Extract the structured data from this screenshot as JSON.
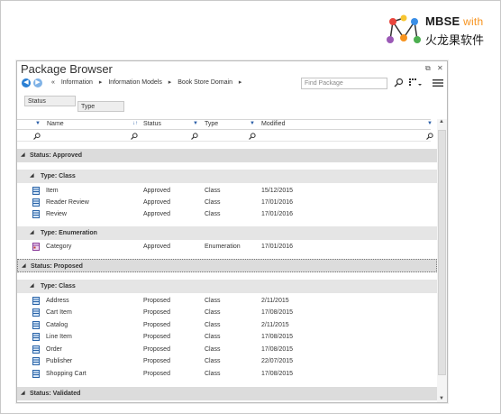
{
  "logo": {
    "brand": "MBSE",
    "with": "with",
    "subtitle": "火龙果软件"
  },
  "window": {
    "title": "Package Browser",
    "pin_glyph": "⧉",
    "close_glyph": "✕"
  },
  "toolbar": {
    "back_glyph": "◀",
    "forward_glyph": "▶",
    "crumbs": [
      "«",
      "Information",
      "Information Models",
      "Book Store Domain"
    ],
    "crumb_sep": "▸",
    "find_placeholder": "Find Package"
  },
  "grouping": {
    "chips": [
      "Status",
      "Type"
    ]
  },
  "columns": {
    "name": "Name",
    "status": "Status",
    "type": "Type",
    "modified": "Modified",
    "sort_glyph": "↓↑"
  },
  "groups": [
    {
      "label": "Status: Approved",
      "subgroups": [
        {
          "label": "Type: Class",
          "rows": [
            {
              "name": "Item",
              "status": "Approved",
              "type": "Class",
              "modified": "15/12/2015",
              "icon": "class-icon"
            },
            {
              "name": "Reader Review",
              "status": "Approved",
              "type": "Class",
              "modified": "17/01/2016",
              "icon": "class-icon"
            },
            {
              "name": "Review",
              "status": "Approved",
              "type": "Class",
              "modified": "17/01/2016",
              "icon": "class-icon"
            }
          ]
        },
        {
          "label": "Type: Enumeration",
          "rows": [
            {
              "name": "Category",
              "status": "Approved",
              "type": "Enumeration",
              "modified": "17/01/2016",
              "icon": "enumeration-icon"
            }
          ]
        }
      ]
    },
    {
      "label": "Status: Proposed",
      "selected": true,
      "subgroups": [
        {
          "label": "Type: Class",
          "rows": [
            {
              "name": "Address",
              "status": "Proposed",
              "type": "Class",
              "modified": "2/11/2015",
              "icon": "class-icon"
            },
            {
              "name": "Cart Item",
              "status": "Proposed",
              "type": "Class",
              "modified": "17/08/2015",
              "icon": "class-icon"
            },
            {
              "name": "Catalog",
              "status": "Proposed",
              "type": "Class",
              "modified": "2/11/2015",
              "icon": "class-icon"
            },
            {
              "name": "Line Item",
              "status": "Proposed",
              "type": "Class",
              "modified": "17/08/2015",
              "icon": "class-icon"
            },
            {
              "name": "Order",
              "status": "Proposed",
              "type": "Class",
              "modified": "17/08/2015",
              "icon": "class-icon"
            },
            {
              "name": "Publisher",
              "status": "Proposed",
              "type": "Class",
              "modified": "22/07/2015",
              "icon": "class-icon"
            },
            {
              "name": "Shopping Cart",
              "status": "Proposed",
              "type": "Class",
              "modified": "17/08/2015",
              "icon": "class-icon"
            }
          ]
        }
      ]
    },
    {
      "label": "Status: Validated",
      "subgroups": []
    }
  ],
  "colors": {
    "accent": "#2a7fd4",
    "logo_orange": "#f7931e",
    "group_bg": "#dcdcdc"
  }
}
